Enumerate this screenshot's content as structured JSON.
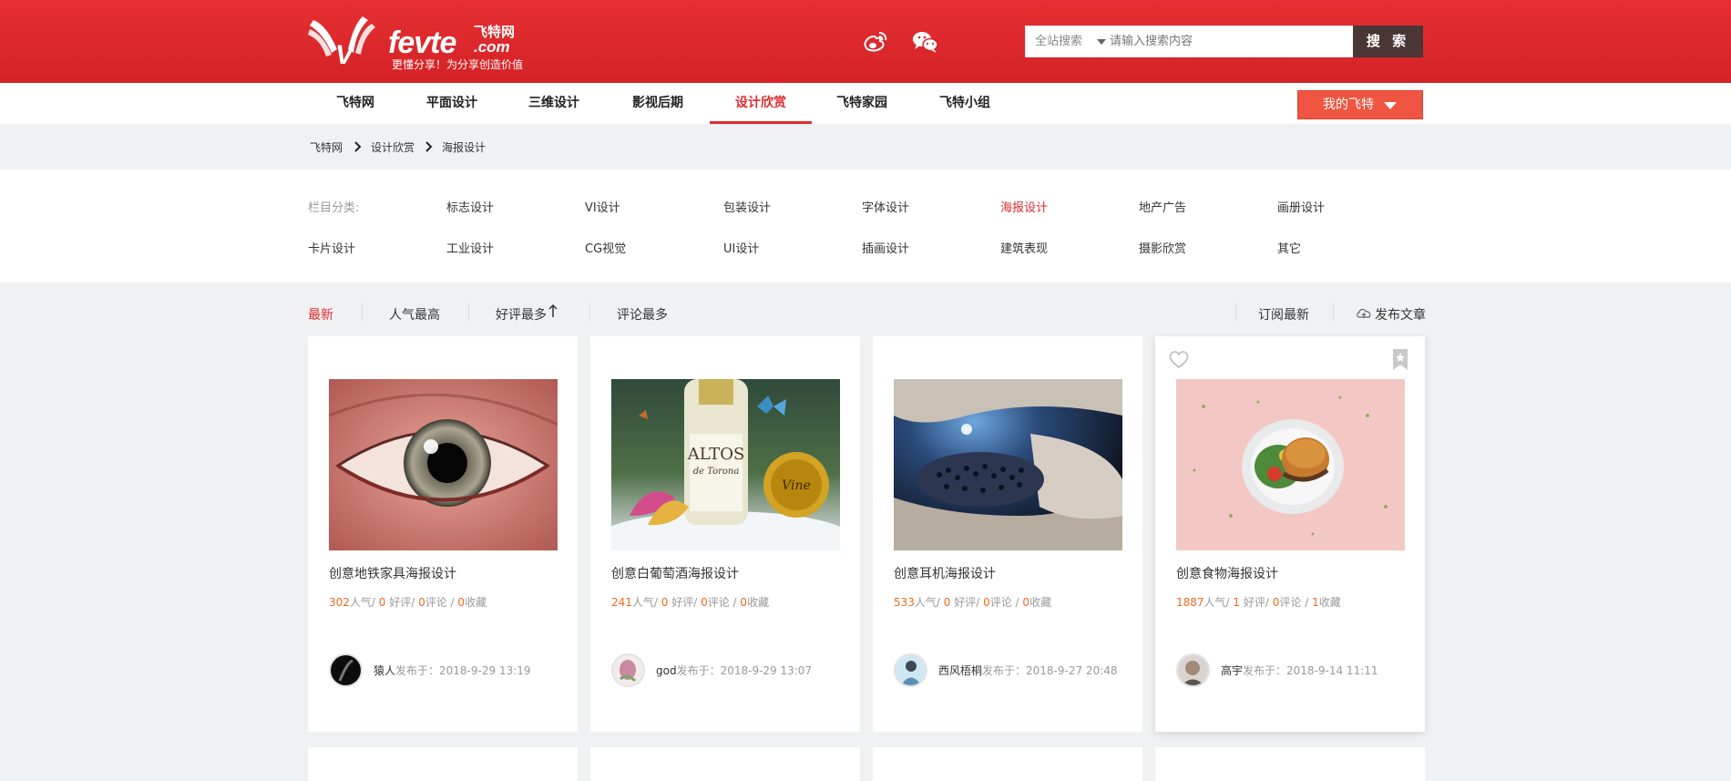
{
  "header": {
    "logo": {
      "text": "fevte",
      "cn": "飞特网",
      "domain": ".com",
      "slogan": "更懂分享！为分享创造价值"
    },
    "social": [
      {
        "icon": "weibo-icon"
      },
      {
        "icon": "wechat-icon"
      }
    ],
    "search": {
      "scope": "全站搜索",
      "placeholder": "请输入搜索内容",
      "button": "搜 索"
    }
  },
  "nav": {
    "items": [
      {
        "label": "飞特网",
        "active": false
      },
      {
        "label": "平面设计",
        "active": false
      },
      {
        "label": "三维设计",
        "active": false
      },
      {
        "label": "影视后期",
        "active": false
      },
      {
        "label": "设计欣赏",
        "active": true
      },
      {
        "label": "飞特家园",
        "active": false
      },
      {
        "label": "飞特小组",
        "active": false
      }
    ],
    "my_button": "我的飞特"
  },
  "breadcrumb": [
    "飞特网",
    "设计欣赏",
    "海报设计"
  ],
  "categories": {
    "label": "栏目分类:",
    "row1": [
      "标志设计",
      "VI设计",
      "包装设计",
      "字体设计",
      "海报设计",
      "地产广告",
      "画册设计"
    ],
    "row2": [
      "卡片设计",
      "工业设计",
      "CG视觉",
      "UI设计",
      "插画设计",
      "建筑表现",
      "摄影欣赏",
      "其它"
    ],
    "active": "海报设计"
  },
  "sort": {
    "tabs": [
      "最新",
      "人气最高",
      "好评最多",
      "评论最多"
    ],
    "active": "最新",
    "subscribe": "订阅最新",
    "publish": "发布文章"
  },
  "cards": [
    {
      "title": "创意地铁家具海报设计",
      "views": "302",
      "views_label": "人气/ ",
      "likes": "0",
      "likes_label": " 好评/ ",
      "comments": "0",
      "comments_label": "评论 / ",
      "favs": "0",
      "favs_label": "收藏",
      "author": "猿人",
      "posted": "发布于：2018-9-29 13:19"
    },
    {
      "title": "创意白葡萄酒海报设计",
      "views": "241",
      "views_label": "人气/ ",
      "likes": "0",
      "likes_label": " 好评/ ",
      "comments": "0",
      "comments_label": "评论 / ",
      "favs": "0",
      "favs_label": "收藏",
      "author": "god",
      "posted": "发布于：2018-9-29 13:07",
      "bottle_text": "ALTOS",
      "bottle_sub": "de Torona",
      "seal_text": "Vine"
    },
    {
      "title": "创意耳机海报设计",
      "views": "533",
      "views_label": "人气/ ",
      "likes": "0",
      "likes_label": " 好评/ ",
      "comments": "0",
      "comments_label": "评论 / ",
      "favs": "0",
      "favs_label": "收藏",
      "author": "西风梧桐",
      "posted": "发布于：2018-9-27 20:48"
    },
    {
      "title": "创意食物海报设计",
      "views": "1887",
      "views_label": "人气/ ",
      "likes": "1",
      "likes_label": " 好评/ ",
      "comments": "0",
      "comments_label": "评论 / ",
      "favs": "1",
      "favs_label": "收藏",
      "author": "高宇",
      "posted": "发布于：2018-9-14 11:11"
    }
  ],
  "colors": {
    "brand_red": "#e02b2f",
    "accent_orange": "#f06a1d",
    "search_btn": "#4a3735",
    "my_btn": "#ef5540"
  }
}
